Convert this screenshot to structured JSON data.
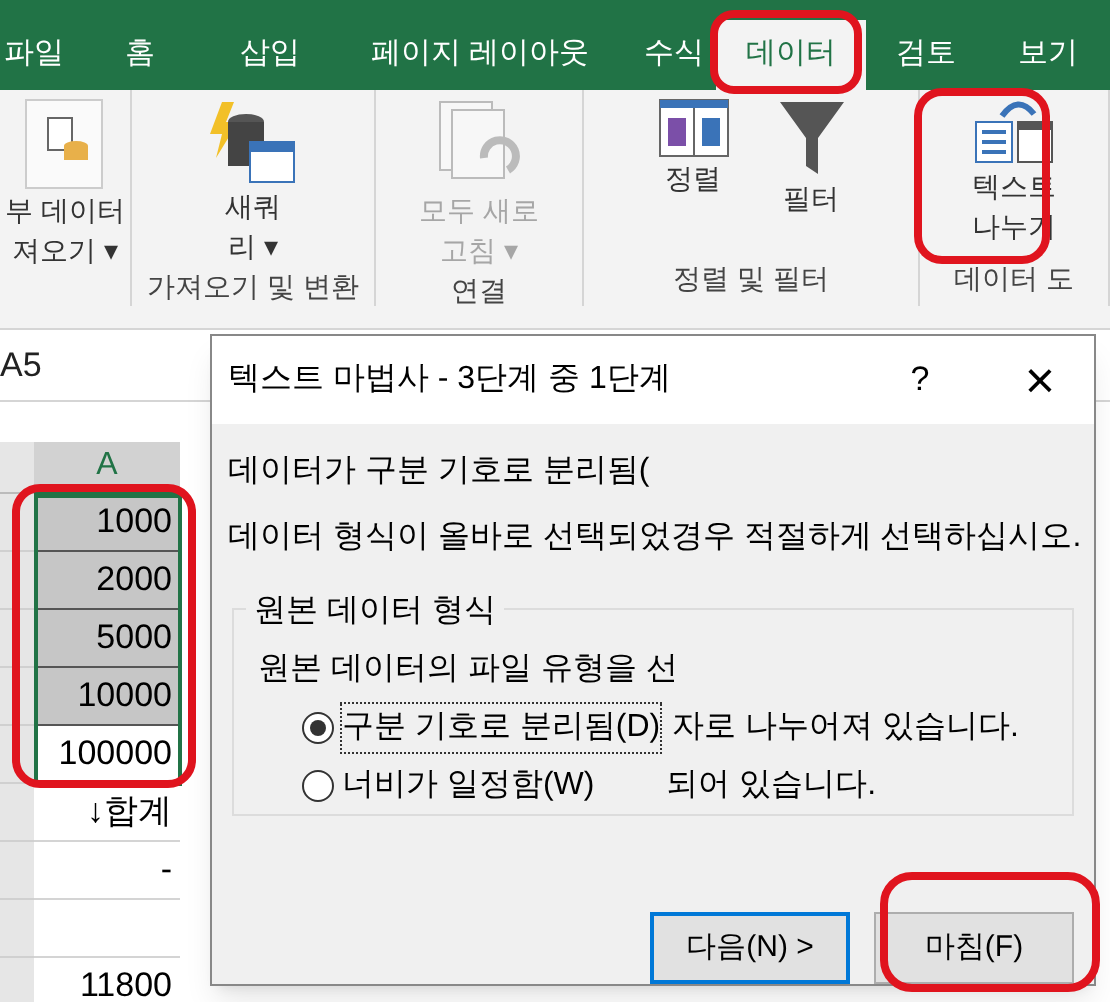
{
  "tabs": [
    {
      "label": "파일",
      "selected": false
    },
    {
      "label": "홈",
      "selected": false
    },
    {
      "label": "삽입",
      "selected": false
    },
    {
      "label": "페이지 레이아웃",
      "selected": false
    },
    {
      "label": "수식",
      "selected": false
    },
    {
      "label": "데이터",
      "selected": true
    },
    {
      "label": "검토",
      "selected": false
    },
    {
      "label": "보기",
      "selected": false
    }
  ],
  "ribbon": {
    "groups": [
      {
        "buttons": [
          {
            "kind": "external",
            "lines": [
              "부 데이터",
              "져오기 ▾"
            ],
            "disabled": false
          }
        ]
      },
      {
        "label": "가져오기 및 변환",
        "buttons": [
          {
            "kind": "query",
            "lines": [
              "새쿼",
              "리 ▾"
            ],
            "disabled": false
          }
        ]
      },
      {
        "label": "연결",
        "buttons": [
          {
            "kind": "refresh",
            "lines": [
              "모두 새로",
              "고침 ▾"
            ],
            "disabled": true
          }
        ]
      },
      {
        "label": "정렬 및 필터",
        "buttons": [
          {
            "kind": "sort",
            "lines": [
              "정렬"
            ],
            "disabled": false
          },
          {
            "kind": "filter",
            "lines": [
              "필터"
            ],
            "disabled": false
          }
        ]
      },
      {
        "label": "데이터 도",
        "buttons": [
          {
            "kind": "split",
            "lines": [
              "텍스트",
              "나누기"
            ],
            "disabled": false
          }
        ]
      }
    ]
  },
  "name_box": {
    "value": "A5"
  },
  "sheet": {
    "column_header": "A",
    "rows": [
      {
        "value": "1000",
        "selected": true
      },
      {
        "value": "2000",
        "selected": true
      },
      {
        "value": "5000",
        "selected": true
      },
      {
        "value": "10000",
        "selected": true
      },
      {
        "value": "100000",
        "selected": false
      },
      {
        "value": "↓합계",
        "selected": false
      },
      {
        "value": "-",
        "selected": false
      },
      {
        "value": "",
        "selected": false
      },
      {
        "value": "11800",
        "selected": false
      }
    ]
  },
  "dialog": {
    "title": "텍스트 마법사 - 3단계 중 1단계",
    "help": "?",
    "close": "×",
    "lines": [
      "데이터가 구분 기호로 분리됨(",
      "데이터 형식이 올바로 선택되었경우 적절하게 선택하십시오."
    ],
    "group_title": "원본 데이터 형식",
    "prompt": "원본 데이터의 파일 유형을 선",
    "options": [
      {
        "label": "구분 기호로 분리됨(D)",
        "description": "자로 나누어져 있습니다.",
        "selected": true
      },
      {
        "label": "너비가 일정함(W)",
        "description": "되어 있습니다.",
        "selected": false
      }
    ],
    "buttons": [
      {
        "label": "다음(N) >",
        "focused": true
      },
      {
        "label": "마침(F)",
        "focused": false
      }
    ]
  }
}
